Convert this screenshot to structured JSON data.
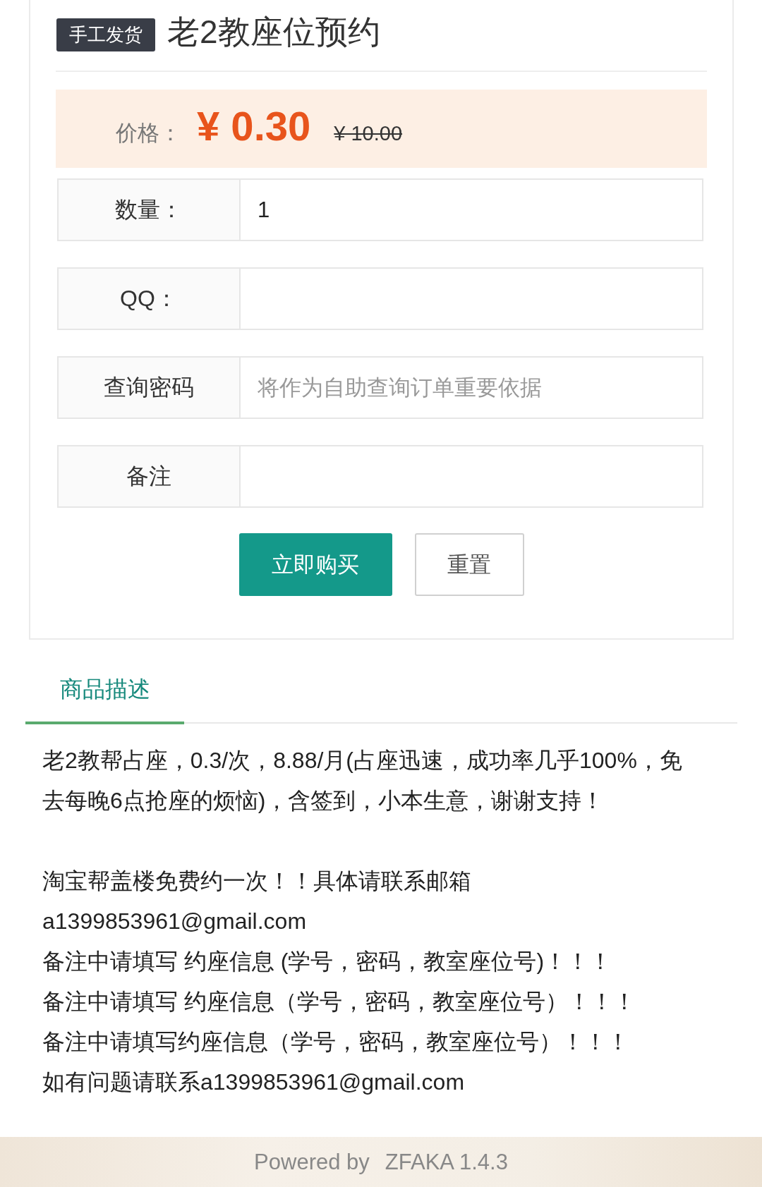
{
  "product": {
    "badge": "手工发货",
    "title": "老2教座位预约"
  },
  "price": {
    "label": "价格：",
    "current": "¥ 0.30",
    "original": "¥ 10.00"
  },
  "form": {
    "fields": [
      {
        "label": "数量：",
        "value": "1"
      },
      {
        "label": "QQ："
      },
      {
        "label": "查询密码",
        "placeholder": "将作为自助查询订单重要依据"
      },
      {
        "label": "备注"
      }
    ]
  },
  "buttons": [
    {
      "label": "立即购买",
      "kind": "primary"
    },
    {
      "label": "重置",
      "kind": "default"
    }
  ],
  "tabs": [
    {
      "label": "商品描述",
      "selected": true
    }
  ],
  "description": {
    "paragraphs": [
      "老2教帮占座，0.3/次，8.88/月(占座迅速，成功率几乎100%，免去每晚6点抢座的烦恼)，含签到，小本生意，谢谢支持！",
      "淘宝帮盖楼免费约一次！！具体请联系邮箱a1399853961@gmail.com",
      "备注中请填写 约座信息 (学号，密码，教室座位号)！！！",
      "备注中请填写 约座信息（学号，密码，教室座位号）！！！",
      "备注中请填写约座信息（学号，密码，教室座位号）！！！",
      "如有问题请联系a1399853961@gmail.com"
    ]
  },
  "footer": {
    "powered_by": "Powered by",
    "version": "ZFAKA 1.4.3"
  }
}
